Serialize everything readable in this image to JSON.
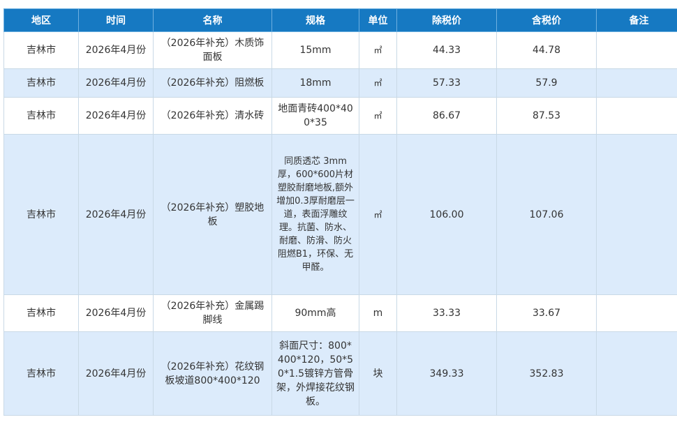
{
  "headers": [
    "地区",
    "时间",
    "名称",
    "规格",
    "单位",
    "除税价",
    "含税价",
    "备注"
  ],
  "rows": [
    {
      "region": "吉林市",
      "time": "2026年4月份",
      "name": "（2026年补充）木质饰面板",
      "spec": "15mm",
      "unit": "㎡",
      "price_ex_tax": "44.33",
      "price_inc_tax": "44.78",
      "note": ""
    },
    {
      "region": "吉林市",
      "time": "2026年4月份",
      "name": "（2026年补充）阻燃板",
      "spec": "18mm",
      "unit": "㎡",
      "price_ex_tax": "57.33",
      "price_inc_tax": "57.9",
      "note": ""
    },
    {
      "region": "吉林市",
      "time": "2026年4月份",
      "name": "（2026年补充）清水砖",
      "spec": "地面青砖400*400*35",
      "unit": "㎡",
      "price_ex_tax": "86.67",
      "price_inc_tax": "87.53",
      "note": ""
    },
    {
      "region": "吉林市",
      "time": "2026年4月份",
      "name": "（2026年补充）塑胶地板",
      "spec": "同质透芯 3mm厚，600*600片材塑胶耐磨地板,额外增加0.3厚耐磨层一道，表面浮雕纹理。抗菌、防水、耐磨、防滑、防火阻燃B1，环保、无甲醛。",
      "unit": "㎡",
      "price_ex_tax": "106.00",
      "price_inc_tax": "107.06",
      "note": ""
    },
    {
      "region": "吉林市",
      "time": "2026年4月份",
      "name": "（2026年补充）金属踢脚线",
      "spec": "90mm高",
      "unit": "m",
      "price_ex_tax": "33.33",
      "price_inc_tax": "33.67",
      "note": ""
    },
    {
      "region": "吉林市",
      "time": "2026年4月份",
      "name": "（2026年补充）花纹钢板坡道800*400*120",
      "spec": "斜面尺寸：800*400*120，50*50*1.5镀锌方管骨架，外焊接花纹钢板。",
      "unit": "块",
      "price_ex_tax": "349.33",
      "price_inc_tax": "352.83",
      "note": ""
    }
  ]
}
